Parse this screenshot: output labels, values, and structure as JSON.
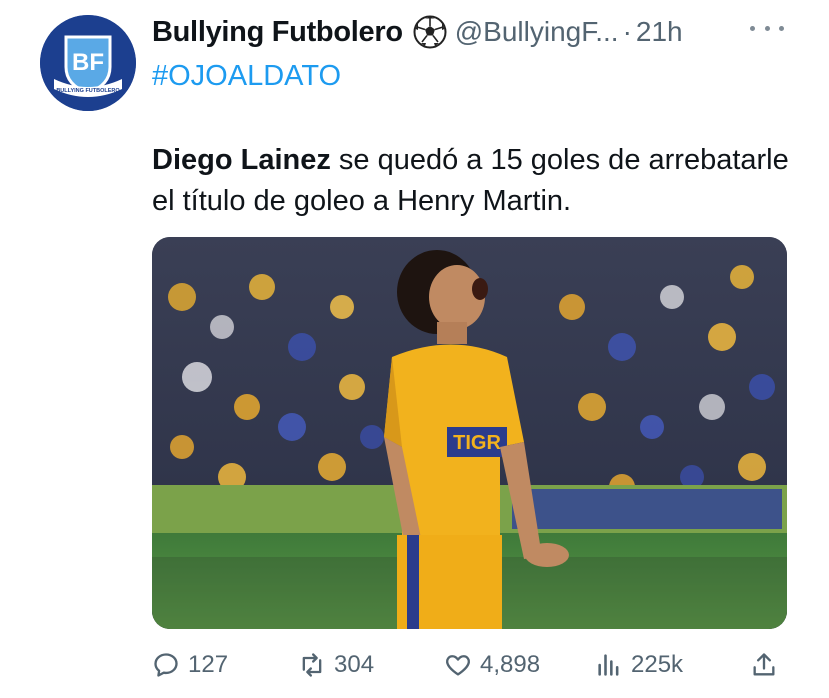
{
  "author": {
    "name": "Bullying Futbolero",
    "handle": "@BullyingF...",
    "separator": "·",
    "time": "21h",
    "avatar_initials": "BF",
    "avatar_banner": "BULLYING FUTBOLERO"
  },
  "hashtag": "#OJOALDATO",
  "tweet": {
    "bold": "Diego Lainez",
    "rest": " se quedó a 15 goles de arrebatarle el título de goleo a Henry Martin."
  },
  "media": {
    "jersey_text": "TIGR"
  },
  "actions": {
    "replies": "127",
    "retweets": "304",
    "likes": "4,898",
    "views": "225k"
  },
  "colors": {
    "accent": "#1d9bf0",
    "muted": "#536471",
    "avatar_bg": "#1c3f8f",
    "jersey": "#f2b21d"
  },
  "icons": [
    "soccer-ball-icon",
    "more-icon",
    "reply-icon",
    "retweet-icon",
    "like-icon",
    "views-icon",
    "share-icon"
  ]
}
